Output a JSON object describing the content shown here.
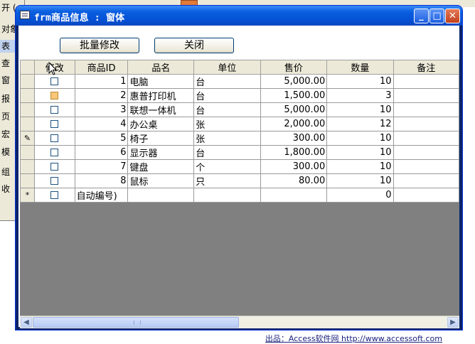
{
  "background_window": {
    "rows": [
      "开 (",
      "对象",
      "表",
      "查",
      "窗",
      "报",
      "页",
      "宏",
      "模",
      "组",
      "收"
    ]
  },
  "window": {
    "title": "frm商品信息 : 窗体",
    "controls": {
      "minimize": "_",
      "maximize": "□",
      "close": "✕"
    }
  },
  "toolbar": {
    "batch_edit_label": "批量修改",
    "close_label": "关闭"
  },
  "table": {
    "headers": [
      "修改",
      "商品ID",
      "品名",
      "单位",
      "售价",
      "数量",
      "备注"
    ],
    "rows": [
      {
        "id": "1",
        "name": "电脑",
        "unit": "台",
        "price": "5,000.00",
        "qty": "10",
        "note": ""
      },
      {
        "id": "2",
        "name": "惠普打印机",
        "unit": "台",
        "price": "1,500.00",
        "qty": "3",
        "note": ""
      },
      {
        "id": "3",
        "name": "联想一体机",
        "unit": "台",
        "price": "5,000.00",
        "qty": "10",
        "note": ""
      },
      {
        "id": "4",
        "name": "办公桌",
        "unit": "张",
        "price": "2,000.00",
        "qty": "12",
        "note": ""
      },
      {
        "id": "5",
        "name": "椅子",
        "unit": "张",
        "price": "300.00",
        "qty": "10",
        "note": ""
      },
      {
        "id": "6",
        "name": "显示器",
        "unit": "台",
        "price": "1,800.00",
        "qty": "10",
        "note": ""
      },
      {
        "id": "7",
        "name": "键盘",
        "unit": "个",
        "price": "300.00",
        "qty": "10",
        "note": ""
      },
      {
        "id": "8",
        "name": "鼠标",
        "unit": "只",
        "price": "80.00",
        "qty": "10",
        "note": ""
      }
    ],
    "new_row": {
      "marker": "*",
      "id": "自动编号)",
      "qty": "0"
    },
    "edit_marker": "✎"
  },
  "footer": {
    "credit": "出品：Access软件网 http://www.accessoft.com"
  },
  "colors": {
    "titlebar": "#0652d6",
    "datasheet_bg": "#808080",
    "highlight_checkbox": "#f6c77a"
  }
}
